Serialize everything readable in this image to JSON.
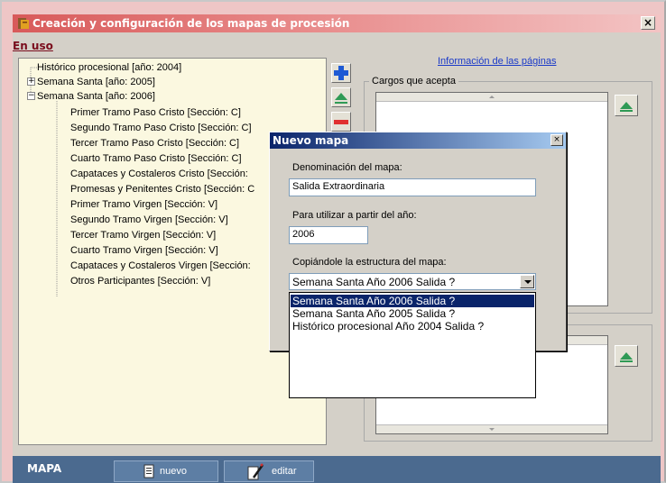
{
  "window": {
    "title": "Creación y configuración de los mapas de procesión",
    "close_glyph": "×"
  },
  "en_uso_label": "En uso",
  "tree": {
    "items": [
      "Histórico procesional [año: 2004]",
      "Semana Santa [año: 2005]",
      "Semana Santa [año: 2006]",
      "Primer Tramo Paso Cristo [Sección: C]",
      "Segundo Tramo Paso Cristo [Sección: C]",
      "Tercer Tramo Paso Cristo [Sección: C]",
      "Cuarto Tramo Paso Cristo [Sección: C]",
      "Capataces y Costaleros  Cristo [Sección:",
      "Promesas y Penitentes Cristo [Sección: C",
      "Primer Tramo Virgen [Sección: V]",
      "Segundo Tramo Virgen [Sección: V]",
      "Tercer Tramo Virgen [Sección: V]",
      "Cuarto Tramo Virgen [Sección: V]",
      "Capataces y Costaleros Virgen [Sección:",
      "Otros Participantes [Sección: V]"
    ],
    "expanders": [
      "+",
      "−"
    ]
  },
  "right_panel": {
    "info_link": "Información de las páginas",
    "cargos_label": "Cargos que acepta"
  },
  "bottom": {
    "mapa_label": "MAPA",
    "nuevo_label": "nuevo",
    "editar_label": "editar"
  },
  "dialog": {
    "title": "Nuevo mapa",
    "close_glyph": "×",
    "denominacion_label": "Denominación del mapa:",
    "denominacion_value": "Salida Extraordinaria",
    "anio_label": "Para utilizar a partir del año:",
    "anio_value": "2006",
    "copiar_label": "Copiándole la estructura del mapa:",
    "combo_value": "Semana Santa Año 2006 Salida  ?",
    "options": [
      "Semana Santa Año 2006 Salida  ?",
      "Semana Santa Año 2005 Salida  ?",
      "Histórico procesional Año 2004 Salida  ?"
    ]
  },
  "colors": {
    "title_red": "#d85a5a",
    "en_uso": "#7a0c1c",
    "tree_bg": "#fbf8e0",
    "bottom_bar": "#4b6a8f",
    "dialog_title": "#0a246a",
    "plus_blue": "#1e5ad4",
    "up_green": "#2f9a55",
    "minus_red": "#e03030"
  }
}
